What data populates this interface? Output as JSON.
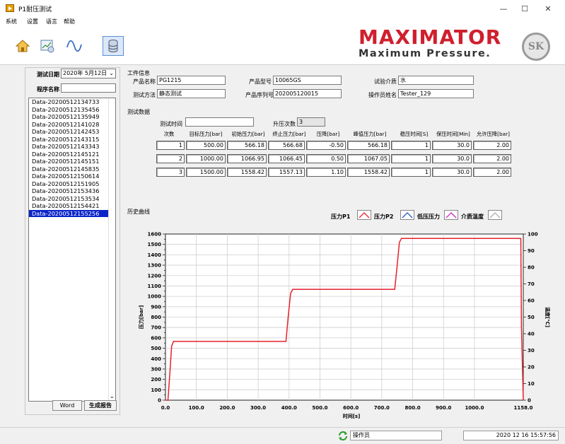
{
  "window": {
    "title": "P1耐压测试",
    "minimize": "—",
    "maximize": "☐",
    "close": "✕"
  },
  "menu": [
    "系统",
    "设置",
    "语言",
    "帮助"
  ],
  "brand": {
    "name": "MAXIMATOR",
    "slogan": "Maximum Pressure.",
    "seal": "SK"
  },
  "left": {
    "date_label": "测试日期",
    "date_value": "2020年 5月12日",
    "product_label": "程序名称",
    "product_value": "",
    "records": [
      "Data-20200512134733",
      "Data-20200512135456",
      "Data-20200512135949",
      "Data-20200512141028",
      "Data-20200512142453",
      "Data-20200512143115",
      "Data-20200512143343",
      "Data-20200512145121",
      "Data-20200512145151",
      "Data-20200512145835",
      "Data-20200512150614",
      "Data-20200512151905",
      "Data-20200512153436",
      "Data-20200512153534",
      "Data-20200512154421",
      "Data-20200512155256"
    ],
    "selected_index": 15,
    "btn_word": "Word",
    "btn_report": "生成报告"
  },
  "work": {
    "section": "工件信息",
    "product_name_label": "产品名称",
    "product_name": "PG1215",
    "product_model_label": "产品型号",
    "product_model": "10065GS",
    "medium_label": "试验介质",
    "medium": "水",
    "method_label": "测试方法",
    "method": "静态测试",
    "serial_label": "产品序列号",
    "serial": "202005120015",
    "operator_label": "操作员姓名",
    "operator": "Tester_129"
  },
  "test": {
    "section": "测试数据",
    "time_label": "测试时间",
    "time_value": "",
    "count_label": "升压次数",
    "count_value": "3",
    "headers": [
      "次数",
      "目标压力[bar]",
      "初始压力[bar]",
      "终止压力[bar]",
      "压降[bar]",
      "峰值压力[bar]",
      "稳压时间[S]",
      "保压时间[Min]",
      "允许压降[bar]"
    ],
    "rows": [
      [
        "1",
        "500.00",
        "566.18",
        "566.68",
        "-0.50",
        "566.18",
        "1",
        "30.0",
        "2.00"
      ],
      [
        "2",
        "1000.00",
        "1066.95",
        "1066.45",
        "0.50",
        "1067.05",
        "1",
        "30.0",
        "2.00"
      ],
      [
        "3",
        "1500.00",
        "1558.42",
        "1557.13",
        "1.10",
        "1558.42",
        "1",
        "30.0",
        "2.00"
      ]
    ]
  },
  "history": {
    "section": "历史曲线",
    "legend": [
      "压力P1",
      "压力P2",
      "低压压力",
      "介质温度"
    ]
  },
  "colors": {
    "pressure": "#e8202a",
    "brand": "#d01f2e",
    "selected": "#0a24c8"
  },
  "chart_data": {
    "type": "line",
    "xlabel": "时间[s]",
    "ylabel": "压力[bar]",
    "y2label": "温度[℃]",
    "xlim": [
      0,
      1158
    ],
    "ylim": [
      0,
      1600
    ],
    "y2lim": [
      0,
      100
    ],
    "x_ticks": [
      "0.0",
      "100.0",
      "200.0",
      "300.0",
      "400.0",
      "500.0",
      "600.0",
      "700.0",
      "800.0",
      "900.0",
      "1000.0",
      "1158.0"
    ],
    "x_tick_values": [
      0,
      100,
      200,
      300,
      400,
      500,
      600,
      700,
      800,
      900,
      1000,
      1158
    ],
    "y_ticks": [
      0,
      50,
      100,
      150,
      200,
      250,
      300,
      350,
      400,
      450,
      500,
      550,
      600,
      650,
      700,
      750,
      800,
      850,
      900,
      950,
      1000,
      1050,
      1100,
      1150,
      1200,
      1250,
      1300,
      1350,
      1400,
      1450,
      1500,
      1550,
      1600
    ],
    "y2_ticks": [
      0,
      10,
      20,
      30,
      40,
      50,
      60,
      70,
      80,
      90,
      100
    ],
    "grid": true,
    "series": [
      {
        "name": "压力P1",
        "x": [
          0,
          8,
          14,
          20,
          26,
          390,
          397,
          405,
          412,
          742,
          750,
          757,
          764,
          1150,
          1152,
          1158
        ],
        "y": [
          0,
          0,
          250,
          520,
          566,
          566,
          800,
          1030,
          1067,
          1067,
          1300,
          1520,
          1558,
          1558,
          700,
          0
        ]
      }
    ]
  },
  "status": {
    "text": "操作员",
    "datetime": "2020 12 16 15:57:56"
  }
}
